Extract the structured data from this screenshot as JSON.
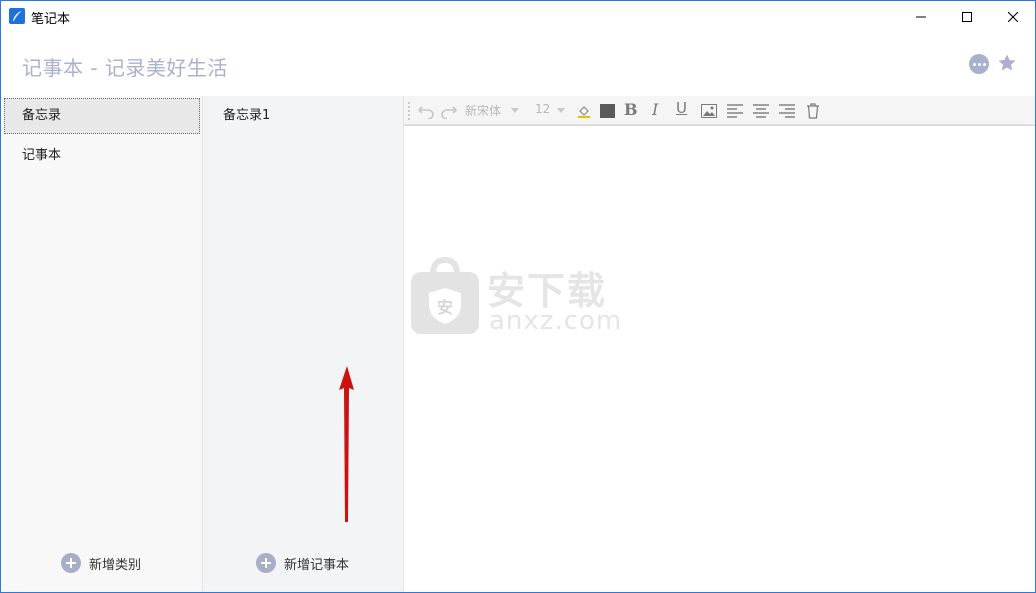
{
  "window": {
    "title": "笔记本",
    "icon": "feather-pen-icon"
  },
  "header": {
    "title": "记事本 - 记录美好生活",
    "more_icon": "more-dots-icon",
    "star_icon": "star-icon"
  },
  "categories": {
    "items": [
      {
        "label": "备忘录",
        "active": true
      },
      {
        "label": "记事本",
        "active": false
      }
    ],
    "add_label": "新增类别"
  },
  "notes": {
    "items": [
      {
        "label": "备忘录1"
      }
    ],
    "add_label": "新增记事本"
  },
  "editor": {
    "toolbar": {
      "font_name": "新宋体",
      "font_size": "12",
      "bold_label": "B",
      "italic_label": "I",
      "underline_label": "U"
    },
    "content": ""
  },
  "watermark": {
    "text_cn": "安下载",
    "text_en": "anxz.com",
    "shield_label": "安"
  },
  "colors": {
    "accent": "#a9b1cf",
    "window_border": "#2b79d8",
    "annotation_arrow": "#cc1111",
    "text_color_swatch": "#5a5a5a"
  }
}
